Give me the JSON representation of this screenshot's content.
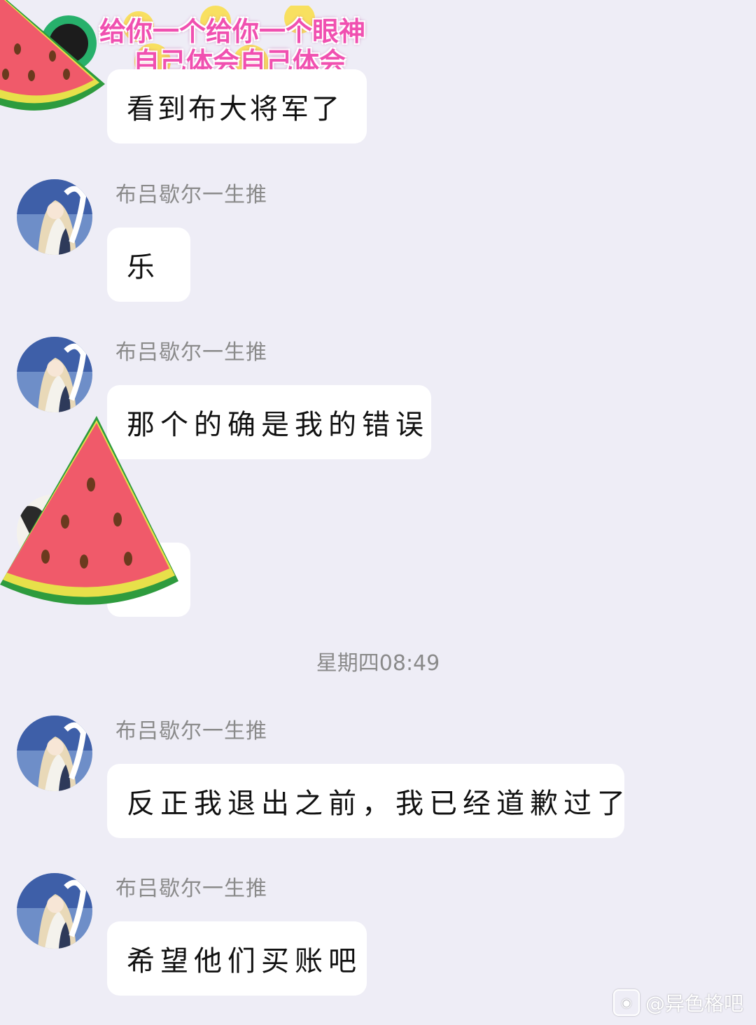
{
  "header_sticker": {
    "line1": "给你一个给你一个眼神",
    "line2": "自己体会自己体会"
  },
  "messages": [
    {
      "sender": "",
      "text": "看到布大将军了"
    },
    {
      "sender": "布吕歇尔一生推",
      "text": "乐"
    },
    {
      "sender": "布吕歇尔一生推",
      "text": "那个的确是我的错误"
    },
    {
      "sender": "",
      "text": ""
    },
    {
      "sender": "布吕歇尔一生推",
      "text": "反正我退出之前，我已经道歉过了"
    },
    {
      "sender": "布吕歇尔一生推",
      "text": "希望他们买账吧"
    }
  ],
  "timestamp": "星期四08:49",
  "watermark": {
    "icon": "weibo-logo-icon",
    "text": "@异色格吧"
  },
  "colors": {
    "background": "#EEEDF6",
    "bubble": "#FFFFFF",
    "name": "#8A8A8A",
    "melon": "#F05A6A",
    "rind": "#2E9B3E"
  }
}
